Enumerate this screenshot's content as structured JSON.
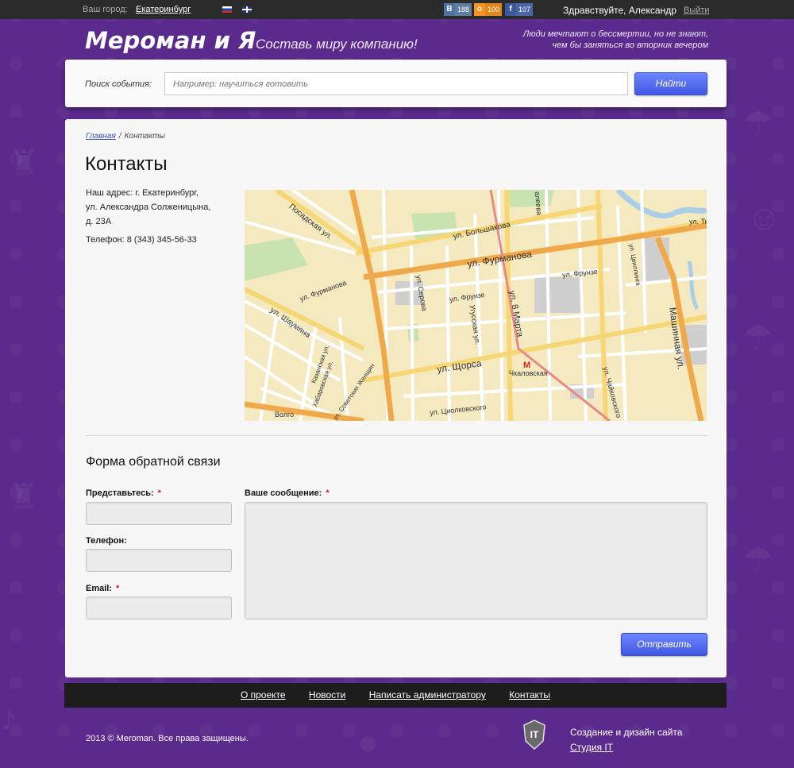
{
  "topbar": {
    "city_label": "Ваш город:",
    "city": "Екатеринбург",
    "social": {
      "vk": {
        "icon": "В",
        "count": "188"
      },
      "ok": {
        "icon": "о",
        "count": "100"
      },
      "fb": {
        "icon": "f",
        "count": "107"
      }
    },
    "greeting": "Здравствуйте, Александр",
    "logout": "Выйти"
  },
  "header": {
    "logo": "Мероман и Я",
    "tagline": "Составь миру компанию!",
    "quote_line1": "Люди мечтают о бессмертии, но не знают,",
    "quote_line2": "чем бы заняться во вторник вечером"
  },
  "search": {
    "label": "Поиск события:",
    "placeholder": "Например: научиться готовить",
    "button": "Найти"
  },
  "breadcrumbs": {
    "home": "Главная",
    "separator": "/",
    "current": "Контакты"
  },
  "page": {
    "title": "Контакты",
    "address_line1": "Наш адрес: г. Екатеринбург,",
    "address_line2": "ул. Александра Солженицына,",
    "address_line3": "д. 23А",
    "phone": "Телефон: 8 (343) 345-56-33"
  },
  "map": {
    "labels": {
      "posadskaya": "Посадская ул.",
      "bolshakova": "ул. Большакова",
      "furmanova": "ул. Фурманова",
      "furmanova2": "ул. Фурманова",
      "shaumyana": "ул. Шаумяна",
      "shchorsa": "ул. Щорса",
      "frunze": "ул. Фрунзе",
      "frunze2": "ул. Фрунзе",
      "serova": "ул. Серова",
      "ugusskaya": "Угусская ул.",
      "vmarta": "ул. 8 Марта",
      "chkalovskaya": "Чкаловская",
      "tsiolkovskogo": "ул. Циолковского",
      "mashinnaya": "Машинная ул.",
      "chaykovskogo": "ул. Чайковского",
      "tsvillinga": "ул. Цвиллинга",
      "kazanskaya": "Казанская ул.",
      "khabarovskaya": "Хабаровская ул.",
      "sovetskikh": "ул. Советских Женщин",
      "aleeva": "алеева",
      "tkach": "ул. Ткач",
      "volgo": "Волго",
      "metro_icon": "М"
    }
  },
  "form": {
    "title": "Форма обратной связи",
    "name_label": "Представьтесь:",
    "phone_label": "Телефон:",
    "email_label": "Email:",
    "message_label": "Ваше сообщение:",
    "required_mark": "*",
    "submit": "Отправить"
  },
  "footer": {
    "nav": [
      "О проекте",
      "Новости",
      "Написать администратору",
      "Контакты"
    ],
    "copyright": "2013 © Meroman. Все права защищены.",
    "studio_line1": "Создание и дизайн сайта",
    "studio_link": "Студия IT",
    "studio_logo_text": "IT"
  },
  "colors": {
    "background": "#5a2a8c",
    "topbar": "#2b2b2b",
    "footer_nav": "#1d1d1d",
    "button": "#4f68f0",
    "required": "#d02020"
  }
}
